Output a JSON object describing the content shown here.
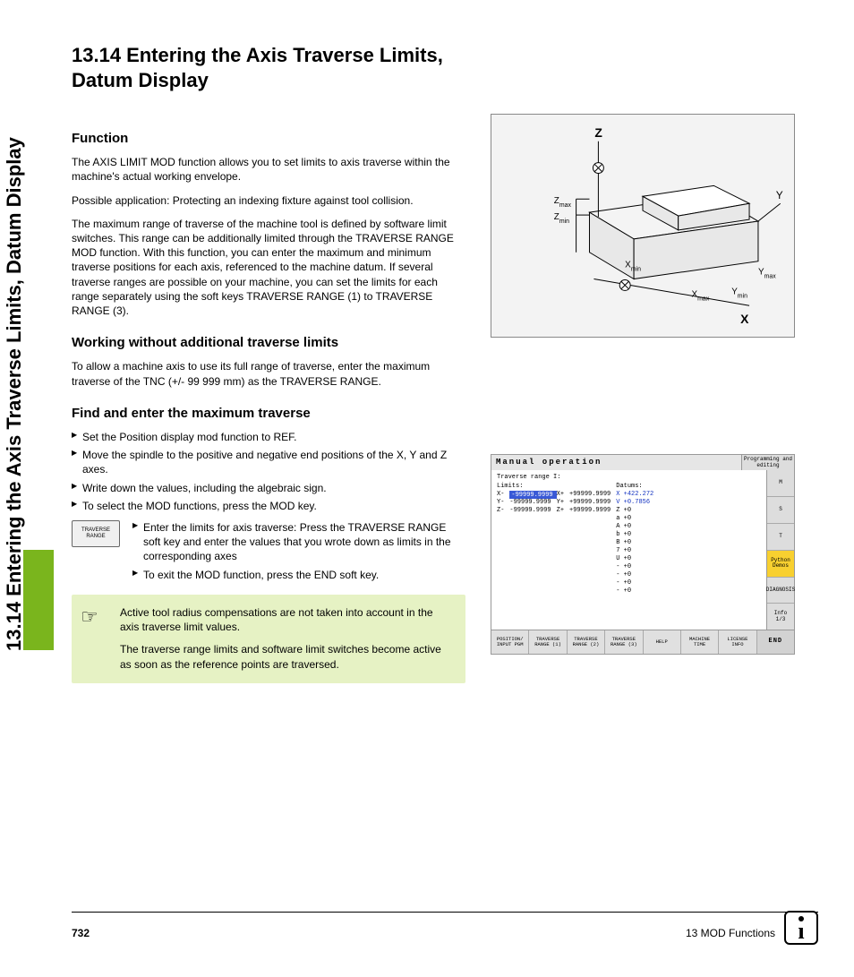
{
  "side_tab": "13.14 Entering the Axis Traverse Limits, Datum Display",
  "title_num": "13.14",
  "title_text": "Entering the Axis Traverse Limits, Datum Display",
  "h_function": "Function",
  "p_function_1": "The AXIS LIMIT MOD function allows you to set limits to axis traverse within the machine's actual working envelope.",
  "p_function_2": "Possible application: Protecting an indexing fixture against tool collision.",
  "p_function_3": "The maximum range of traverse of the machine tool is defined by software limit switches. This range can be additionally limited through the TRAVERSE RANGE MOD function. With this function, you can enter the maximum and minimum traverse positions for each axis, referenced to the machine datum. If several traverse ranges are possible on your machine, you can set the limits for each range separately using the soft keys TRAVERSE RANGE (1) to TRAVERSE RANGE (3).",
  "h_working": "Working without additional traverse limits",
  "p_working_1": "To allow a machine axis to use its full range of traverse, enter the maximum traverse of the TNC (+/- 99 999 mm) as the TRAVERSE RANGE.",
  "h_find": "Find and enter the maximum traverse",
  "steps_a": [
    "Set the Position display mod function to REF.",
    "Move the spindle to the positive and negative end positions of the X, Y and Z axes.",
    "Write down the values, including the algebraic sign.",
    "To select the MOD functions, press the MOD key."
  ],
  "softkey_label": "TRAVERSE RANGE",
  "steps_b": [
    "Enter the limits for axis traverse: Press the TRAVERSE RANGE soft key and enter the values that you wrote down as limits in the corresponding axes",
    "To exit the MOD function, press the END soft key."
  ],
  "note_1": "Active tool radius compensations are not taken into account in the axis traverse limit values.",
  "note_2": "The traverse range limits and software limit switches become active as soon as the reference points are traversed.",
  "diagram": {
    "z": "Z",
    "x": "X",
    "y": "Y",
    "zmax": "Z",
    "zmax_sub": "max",
    "zmin": "Z",
    "zmin_sub": "min",
    "xmin": "X",
    "xmin_sub": "min",
    "xmax": "X",
    "xmax_sub": "max",
    "ymin": "Y",
    "ymin_sub": "min",
    "ymax": "Y",
    "ymax_sub": "max"
  },
  "screen": {
    "title": "Manual operation",
    "mode": "Programming and editing",
    "range_hdr": "Traverse range I:",
    "limits_hdr": "Limits:",
    "datums_hdr": "Datums:",
    "rows_left": [
      [
        "X-",
        "-99999.9999",
        "X+",
        "+99999.9999"
      ],
      [
        "Y-",
        "-99999.9999",
        "Y+",
        "+99999.9999"
      ],
      [
        "Z-",
        "-99999.9999",
        "Z+",
        "+99999.9999"
      ]
    ],
    "rows_right": [
      "X +422.272",
      "V +0.7856",
      "Z +0",
      "a +0",
      "A +0",
      "b +0",
      "B +0",
      "7 +0",
      "U +0",
      "- +0",
      "- +0",
      "- +0",
      "- +0"
    ],
    "side": [
      "M",
      "S",
      "T",
      "Python Demos",
      "DIAGNOSIS",
      "Info 1/3"
    ],
    "softkeys": [
      "POSITION/ INPUT PGM",
      "TRAVERSE RANGE (1)",
      "TRAVERSE RANGE (2)",
      "TRAVERSE RANGE (3)",
      "HELP",
      "MACHINE TIME",
      "LICENSE INFO",
      "END"
    ]
  },
  "footer": {
    "page": "732",
    "chapter": "13 MOD Functions"
  }
}
